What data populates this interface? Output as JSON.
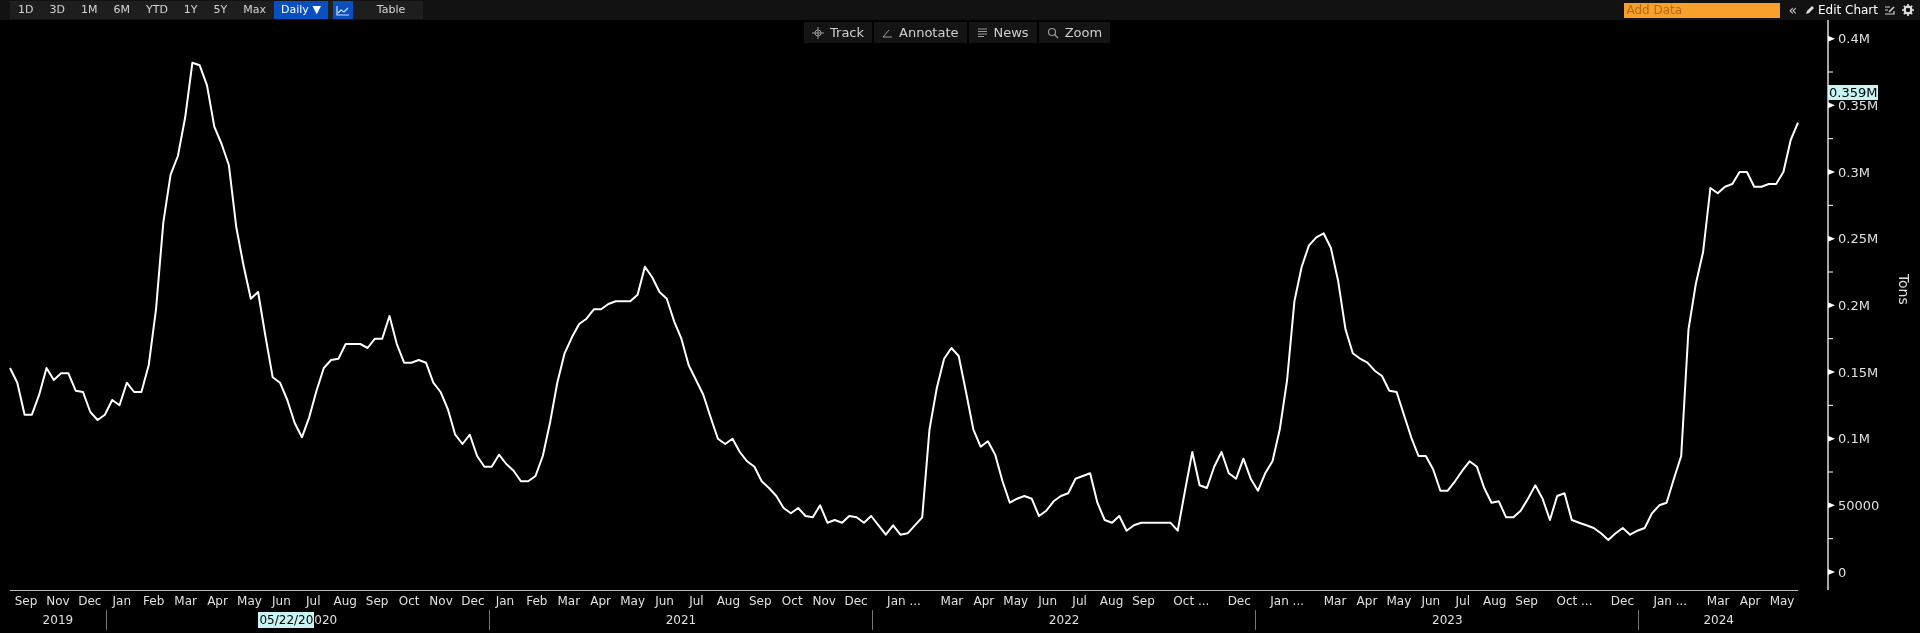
{
  "toolbar": {
    "ranges": [
      {
        "label": "1D",
        "selected": false
      },
      {
        "label": "3D",
        "selected": false
      },
      {
        "label": "1M",
        "selected": false
      },
      {
        "label": "6M",
        "selected": false
      },
      {
        "label": "YTD",
        "selected": false
      },
      {
        "label": "1Y",
        "selected": false
      },
      {
        "label": "5Y",
        "selected": false
      },
      {
        "label": "Max",
        "selected": false
      }
    ],
    "interval": {
      "label": "Daily ▼",
      "selected": true
    },
    "views": [
      {
        "kind": "icon",
        "selected": true
      },
      {
        "kind": "text",
        "label": "Table",
        "selected": false
      }
    ],
    "add_data": {
      "placeholder": "Add Data"
    },
    "collapse": "«",
    "edit_chart": "Edit Chart"
  },
  "chart_tools": [
    {
      "kind": "track",
      "label": "Track"
    },
    {
      "kind": "annotate",
      "label": "Annotate"
    },
    {
      "kind": "news",
      "label": "News"
    },
    {
      "kind": "zoom",
      "label": "Zoom"
    }
  ],
  "chart": {
    "last_value_label": "0.359M",
    "x_axis": {
      "years": [
        {
          "label": "2019",
          "months": [
            {
              "label": "Sep",
              "truncated": false
            },
            {
              "label": "Nov",
              "truncated": false
            },
            {
              "label": "Dec",
              "truncated": false
            }
          ]
        },
        {
          "label": "020",
          "cursor_date": "05/22/20",
          "months": [
            {
              "label": "Jan",
              "truncated": false
            },
            {
              "label": "Feb",
              "truncated": false
            },
            {
              "label": "Mar",
              "truncated": false
            },
            {
              "label": "Apr",
              "truncated": false
            },
            {
              "label": "May",
              "truncated": false
            },
            {
              "label": "Jun",
              "truncated": false
            },
            {
              "label": "Jul",
              "truncated": false
            },
            {
              "label": "Aug",
              "truncated": false
            },
            {
              "label": "Sep",
              "truncated": false
            },
            {
              "label": "Oct",
              "truncated": false
            },
            {
              "label": "Nov",
              "truncated": false
            },
            {
              "label": "Dec",
              "truncated": false
            }
          ]
        },
        {
          "label": "2021",
          "months": [
            {
              "label": "Jan",
              "truncated": false
            },
            {
              "label": "Feb",
              "truncated": false
            },
            {
              "label": "Mar",
              "truncated": false
            },
            {
              "label": "Apr",
              "truncated": false
            },
            {
              "label": "May",
              "truncated": false
            },
            {
              "label": "Jun",
              "truncated": false
            },
            {
              "label": "Jul",
              "truncated": false
            },
            {
              "label": "Aug",
              "truncated": false
            },
            {
              "label": "Sep",
              "truncated": false
            },
            {
              "label": "Oct",
              "truncated": false
            },
            {
              "label": "Nov",
              "truncated": false
            },
            {
              "label": "Dec",
              "truncated": false
            }
          ]
        },
        {
          "label": "2022",
          "months": [
            {
              "label": "Jan ...",
              "truncated": true
            },
            {
              "label": "Mar",
              "truncated": false
            },
            {
              "label": "Apr",
              "truncated": false
            },
            {
              "label": "May",
              "truncated": false
            },
            {
              "label": "Jun",
              "truncated": false
            },
            {
              "label": "Jul",
              "truncated": false
            },
            {
              "label": "Aug",
              "truncated": false
            },
            {
              "label": "Sep",
              "truncated": false
            },
            {
              "label": "Oct ...",
              "truncated": true
            },
            {
              "label": "Dec",
              "truncated": false
            }
          ]
        },
        {
          "label": "2023",
          "months": [
            {
              "label": "Jan ...",
              "truncated": true
            },
            {
              "label": "Mar",
              "truncated": false
            },
            {
              "label": "Apr",
              "truncated": false
            },
            {
              "label": "May",
              "truncated": false
            },
            {
              "label": "Jun",
              "truncated": false
            },
            {
              "label": "Jul",
              "truncated": false
            },
            {
              "label": "Aug",
              "truncated": false
            },
            {
              "label": "Sep",
              "truncated": false
            },
            {
              "label": "Oct ...",
              "truncated": true
            },
            {
              "label": "Dec",
              "truncated": false
            }
          ]
        },
        {
          "label": "2024",
          "months": [
            {
              "label": "Jan ...",
              "truncated": true
            },
            {
              "label": "Mar",
              "truncated": false
            },
            {
              "label": "Apr",
              "truncated": false
            },
            {
              "label": "May",
              "truncated": false
            }
          ]
        }
      ]
    },
    "chart_data": {
      "type": "line",
      "ylabel": "Tons",
      "ylim": [
        -13500,
        414000
      ],
      "categories": [
        null,
        null,
        null,
        null,
        null,
        null,
        null,
        null,
        null,
        null,
        null,
        null,
        null,
        null,
        null,
        null,
        null,
        null,
        null,
        null,
        null,
        null,
        null,
        null,
        null,
        null,
        null,
        null,
        null,
        null,
        null,
        null,
        null,
        null,
        null,
        null,
        null,
        null,
        null,
        null,
        null,
        null,
        null,
        null,
        null,
        null,
        null,
        null,
        null,
        null,
        null,
        null,
        null,
        null,
        null,
        null,
        null,
        null,
        null,
        null,
        null,
        null,
        null,
        null,
        null,
        null,
        null,
        null,
        null,
        null,
        null,
        null,
        null,
        null,
        null,
        null,
        null,
        null,
        null,
        null,
        null,
        null,
        null,
        null,
        null,
        null,
        null,
        null,
        null,
        null,
        null,
        null,
        null,
        null,
        null,
        null,
        null,
        null,
        null,
        null,
        null,
        null,
        null,
        null,
        null,
        null,
        null,
        null,
        null,
        null,
        null,
        null,
        null,
        null,
        null,
        null,
        null,
        null,
        null,
        null,
        null,
        null,
        null,
        null,
        null,
        null,
        null,
        null,
        null,
        null,
        null,
        null,
        null,
        null,
        null,
        null,
        null,
        null,
        null,
        null,
        null,
        null,
        null,
        null,
        null,
        null,
        null,
        null,
        null,
        null,
        null,
        null,
        null,
        null,
        null,
        null,
        null,
        null,
        null,
        null,
        null,
        null,
        null,
        null,
        null,
        null,
        null,
        null,
        null,
        null,
        null,
        null,
        null,
        null,
        null,
        null,
        null,
        null,
        null,
        null,
        null,
        null,
        null,
        null,
        null,
        null,
        null,
        null,
        null,
        null,
        null,
        null,
        null,
        null,
        null,
        null,
        null,
        null,
        null,
        null,
        null,
        null,
        null,
        null,
        null,
        null,
        null,
        null,
        null,
        null,
        null,
        null,
        null,
        null,
        null,
        null,
        null,
        null,
        null,
        null,
        null,
        null,
        null,
        null,
        null,
        null,
        null,
        null,
        null,
        null,
        null,
        null,
        null,
        null,
        null,
        null,
        null,
        null,
        null,
        null,
        null,
        null,
        null,
        null,
        null,
        null
      ],
      "yticks": [
        {
          "value": 0,
          "label": "0"
        },
        {
          "value": 50000,
          "label": "50000"
        },
        {
          "value": 100000,
          "label": "0.1M"
        },
        {
          "value": 150000,
          "label": "0.15M"
        },
        {
          "value": 200000,
          "label": "0.2M"
        },
        {
          "value": 250000,
          "label": "0.25M"
        },
        {
          "value": 300000,
          "label": "0.3M"
        },
        {
          "value": 350000,
          "label": "0.35M"
        },
        {
          "value": 400000,
          "label": "0.4M"
        }
      ],
      "series": [
        {
          "color": "#ffffff",
          "values": [
            153000,
            142000,
            118000,
            118000,
            133000,
            153000,
            144000,
            149000,
            149000,
            136000,
            135000,
            120000,
            114000,
            118000,
            129000,
            125000,
            142000,
            135000,
            135000,
            155000,
            197000,
            262000,
            298000,
            312000,
            341000,
            382000,
            380000,
            365000,
            334000,
            321000,
            305000,
            259000,
            230000,
            205000,
            210000,
            177000,
            146000,
            142000,
            129000,
            112000,
            101000,
            116000,
            136000,
            153000,
            159000,
            160000,
            171000,
            171000,
            171000,
            168000,
            175000,
            175000,
            192000,
            171000,
            157000,
            157000,
            159000,
            157000,
            142000,
            135000,
            122000,
            103000,
            96000,
            103000,
            87000,
            79000,
            79000,
            88000,
            81000,
            76000,
            68000,
            68000,
            72000,
            87000,
            112000,
            142000,
            164000,
            176000,
            186000,
            190000,
            197000,
            197000,
            201000,
            203000,
            203000,
            203000,
            208000,
            229000,
            221000,
            210000,
            205000,
            188000,
            175000,
            155000,
            144000,
            133000,
            116000,
            100000,
            96000,
            100000,
            90000,
            83000,
            79000,
            68000,
            63000,
            57000,
            48000,
            44000,
            48000,
            42000,
            41000,
            50000,
            37000,
            39000,
            37000,
            42000,
            41000,
            37000,
            42000,
            35000,
            28000,
            35000,
            28000,
            29000,
            35000,
            41000,
            107000,
            138000,
            160000,
            168000,
            162000,
            135000,
            107000,
            94000,
            98000,
            88000,
            68000,
            52000,
            55000,
            57000,
            55000,
            42000,
            46000,
            53000,
            57000,
            59000,
            70000,
            72000,
            74000,
            52000,
            39000,
            37000,
            42000,
            31000,
            35000,
            37000,
            37000,
            37000,
            37000,
            37000,
            31000,
            61000,
            90000,
            65000,
            63000,
            79000,
            90000,
            74000,
            70000,
            85000,
            70000,
            61000,
            74000,
            83000,
            107000,
            144000,
            203000,
            229000,
            245000,
            251000,
            254000,
            243000,
            218000,
            182000,
            164000,
            160000,
            157000,
            151000,
            147000,
            136000,
            135000,
            118000,
            101000,
            87000,
            87000,
            77000,
            61000,
            61000,
            68000,
            76000,
            83000,
            79000,
            63000,
            52000,
            53000,
            41000,
            41000,
            46000,
            55000,
            65000,
            55000,
            39000,
            57000,
            59000,
            39000,
            37000,
            35000,
            33000,
            29000,
            24000,
            29000,
            33000,
            28000,
            31000,
            33000,
            44000,
            50000,
            52000,
            70000,
            87000,
            182000,
            216000,
            240000,
            288000,
            284000,
            289000,
            291000,
            300000,
            300000,
            289000,
            289000,
            291000,
            291000,
            300000,
            324000,
            337000
          ]
        }
      ]
    }
  }
}
